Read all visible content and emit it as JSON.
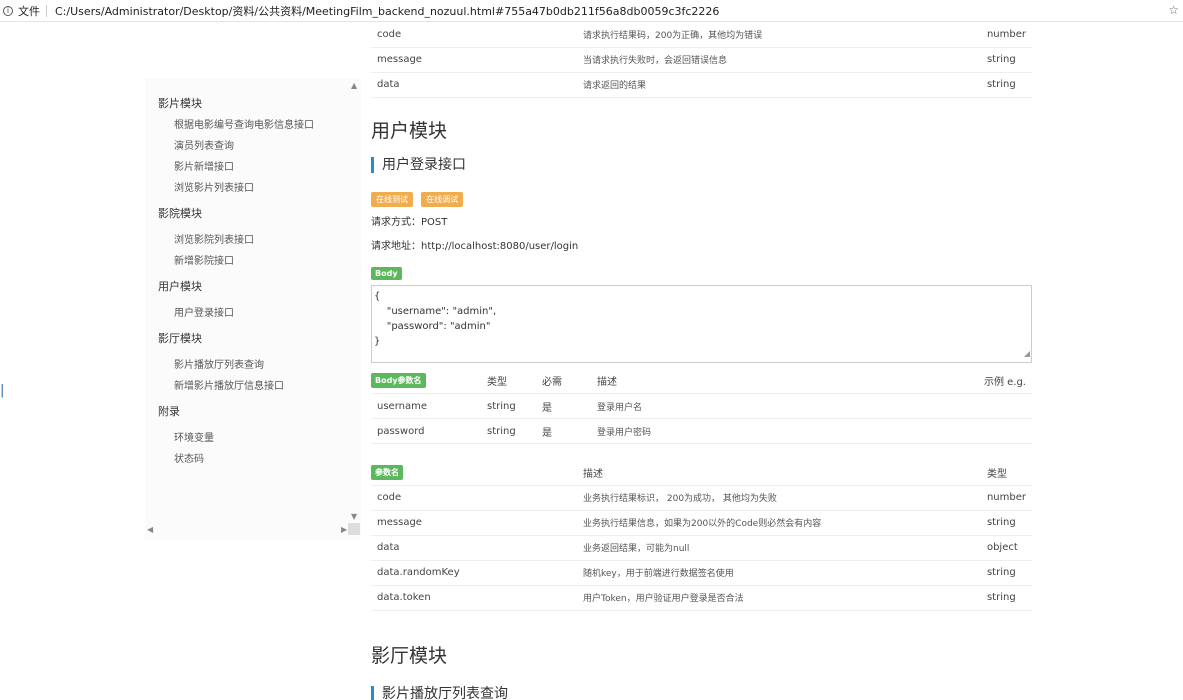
{
  "browser": {
    "file_label": "文件",
    "url": "C:/Users/Administrator/Desktop/资料/公共资料/MeetingFilm_backend_nozuul.html#755a47b0db211f56a8db0059c3fc2226"
  },
  "sidebar": {
    "sections": [
      {
        "title": "影片模块",
        "items": [
          "根据电影编号查询电影信息接口",
          "演员列表查询",
          "影片新增接口",
          "浏览影片列表接口"
        ]
      },
      {
        "title": "影院模块",
        "items": [
          "浏览影院列表接口",
          "新增影院接口"
        ]
      },
      {
        "title": "用户模块",
        "items": [
          "用户登录接口"
        ]
      },
      {
        "title": "影厅模块",
        "items": [
          "影片播放厅列表查询",
          "新增影片播放厅信息接口"
        ]
      },
      {
        "title": "附录",
        "items": [
          "环境变量",
          "状态码"
        ]
      }
    ]
  },
  "prev_response": {
    "rows": [
      {
        "name": "code",
        "desc": "请求执行结果码，200为正确，其他均为错误",
        "type": "number"
      },
      {
        "name": "message",
        "desc": "当请求执行失败时，会返回错误信息",
        "type": "string"
      },
      {
        "name": "data",
        "desc": "请求返回的结果",
        "type": "string"
      }
    ]
  },
  "user_module": {
    "title": "用户模块",
    "api_title": "用户登录接口",
    "btn_test": "在线测试",
    "btn_debug": "在线调试",
    "method_line": "请求方式：POST",
    "url_line": "请求地址：http://localhost:8080/user/login",
    "body_tag": "Body",
    "body_text": "{\n    \"username\": \"admin\",\n    \"password\": \"admin\"\n}",
    "params_header": {
      "tag": "Body参数名",
      "type": "类型",
      "required": "必需",
      "desc": "描述",
      "example": "示例 e.g."
    },
    "params": [
      {
        "name": "username",
        "type": "string",
        "required": "是",
        "desc": "登录用户名"
      },
      {
        "name": "password",
        "type": "string",
        "required": "是",
        "desc": "登录用户密码"
      }
    ],
    "resp_header": {
      "tag": "参数名",
      "desc": "描述",
      "type": "类型"
    },
    "resp": [
      {
        "name": "code",
        "desc": "业务执行结果标识， 200为成功， 其他均为失败",
        "type": "number"
      },
      {
        "name": "message",
        "desc": "业务执行结果信息，如果为200以外的Code则必然会有内容",
        "type": "string"
      },
      {
        "name": "data",
        "desc": "业务返回结果，可能为null",
        "type": "object"
      },
      {
        "name": "data.randomKey",
        "desc": "随机key，用于前端进行数据签名使用",
        "type": "string"
      },
      {
        "name": "data.token",
        "desc": "用户Token，用户验证用户登录是否合法",
        "type": "string"
      }
    ]
  },
  "hall_module": {
    "title": "影厅模块",
    "api_title": "影片播放厅列表查询"
  }
}
